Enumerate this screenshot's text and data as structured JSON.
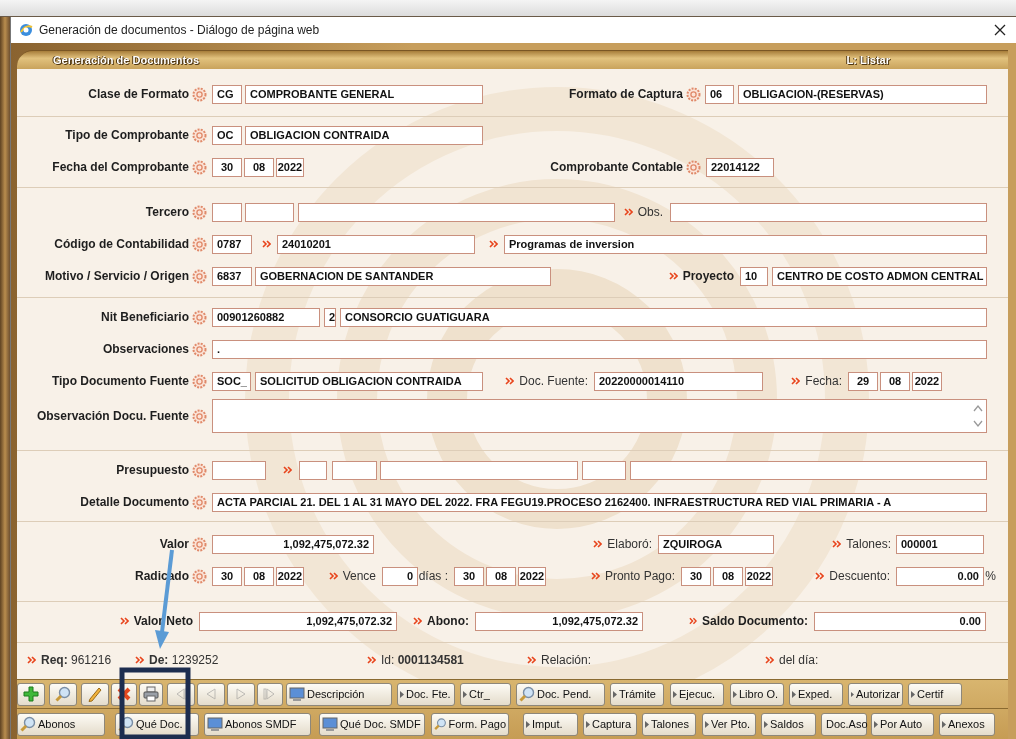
{
  "window": {
    "title": "Generación de documentos - Diálogo de página web"
  },
  "header": {
    "title": "Generación de Documentos",
    "mode": "L: Listar"
  },
  "sections": [
    {
      "rows": [
        {
          "items": [
            {
              "kind": "label",
              "text": "Clase de Formato"
            },
            {
              "kind": "field",
              "value": "CG"
            },
            {
              "kind": "field",
              "value": "COMPROBANTE GENERAL"
            },
            {
              "kind": "label",
              "text": "Formato de Captura"
            },
            {
              "kind": "field",
              "value": "06"
            },
            {
              "kind": "field",
              "value": "OBLIGACION-(RESERVAS)"
            }
          ]
        }
      ]
    },
    {
      "rows": [
        {
          "items": [
            {
              "kind": "label",
              "text": "Tipo de Comprobante"
            },
            {
              "kind": "field",
              "value": "OC"
            },
            {
              "kind": "field",
              "value": "OBLIGACION CONTRAIDA"
            }
          ]
        },
        {
          "items": [
            {
              "kind": "label",
              "text": "Fecha del Comprobante"
            },
            {
              "kind": "date",
              "parts": [
                "30",
                "08",
                "2022"
              ]
            },
            {
              "kind": "label",
              "text": "Comprobante Contable"
            },
            {
              "kind": "field",
              "value": "22014122"
            }
          ]
        }
      ]
    },
    {
      "rows": [
        {
          "items": [
            {
              "kind": "label",
              "text": "Tercero"
            },
            {
              "kind": "field"
            },
            {
              "kind": "field"
            },
            {
              "kind": "field"
            },
            {
              "kind": "caption",
              "chevron": true,
              "text": "Obs."
            },
            {
              "kind": "field"
            }
          ]
        },
        {
          "items": [
            {
              "kind": "label",
              "text": "Código de Contabilidad"
            },
            {
              "kind": "field",
              "value": "0787"
            },
            {
              "kind": "caption",
              "chevron": true
            },
            {
              "kind": "field",
              "value": "24010201"
            },
            {
              "kind": "caption",
              "chevron": true
            },
            {
              "kind": "field",
              "value": "Programas  de inversion"
            }
          ]
        },
        {
          "items": [
            {
              "kind": "label",
              "text": "Motivo / Servicio / Origen"
            },
            {
              "kind": "field",
              "value": "6837"
            },
            {
              "kind": "field",
              "value": "GOBERNACION DE SANTANDER"
            },
            {
              "kind": "bold_caption",
              "chevron": true,
              "text": "Proyecto"
            },
            {
              "kind": "field",
              "value": "10"
            },
            {
              "kind": "field",
              "value": "CENTRO DE COSTO ADMON CENTRAL"
            }
          ]
        }
      ]
    },
    {
      "rows": [
        {
          "items": [
            {
              "kind": "label",
              "text": "Nit Beneficiario"
            },
            {
              "kind": "field",
              "value": "00901260882"
            },
            {
              "kind": "field",
              "value": "2"
            },
            {
              "kind": "field",
              "value": "CONSORCIO GUATIGUARA"
            }
          ]
        },
        {
          "items": [
            {
              "kind": "label",
              "text": "Observaciones"
            },
            {
              "kind": "field",
              "value": "."
            }
          ]
        },
        {
          "items": [
            {
              "kind": "label",
              "text": "Tipo Documento Fuente"
            },
            {
              "kind": "field",
              "value": "SOC_"
            },
            {
              "kind": "field",
              "value": "SOLICITUD OBLIGACION CONTRAIDA"
            },
            {
              "kind": "caption",
              "chevron": true,
              "text": "Doc. Fuente:"
            },
            {
              "kind": "field",
              "value": "20220000014110"
            },
            {
              "kind": "caption",
              "chevron": true,
              "text": "Fecha:"
            },
            {
              "kind": "date",
              "parts": [
                "29",
                "08",
                "2022"
              ]
            }
          ]
        },
        {
          "items": [
            {
              "kind": "label",
              "text": "Observación Docu. Fuente"
            },
            {
              "kind": "textarea"
            }
          ]
        }
      ]
    },
    {
      "rows": [
        {
          "items": [
            {
              "kind": "label",
              "text": "Presupuesto"
            },
            {
              "kind": "field"
            },
            {
              "kind": "caption",
              "chevron": true
            },
            {
              "kind": "field"
            },
            {
              "kind": "field"
            },
            {
              "kind": "field"
            },
            {
              "kind": "field"
            },
            {
              "kind": "field"
            }
          ]
        },
        {
          "items": [
            {
              "kind": "label",
              "text": "Detalle Documento"
            },
            {
              "kind": "field",
              "value": "ACTA PARCIAL 21. DEL 1 AL 31 MAYO DEL 2022. FRA FEGU19.PROCESO 2162400. INFRAESTRUCTURA RED VIAL PRIMARIA - A"
            }
          ]
        }
      ]
    },
    {
      "rows": [
        {
          "items": [
            {
              "kind": "label",
              "text": "Valor"
            },
            {
              "kind": "amount",
              "value": "1,092,475,072.32"
            },
            {
              "kind": "caption",
              "chevron": true,
              "text": "Elaboró:"
            },
            {
              "kind": "field",
              "value": "ZQUIROGA"
            },
            {
              "kind": "caption",
              "chevron": true,
              "text": "Talones:"
            },
            {
              "kind": "field",
              "value": "000001"
            }
          ]
        },
        {
          "items": [
            {
              "kind": "label",
              "text": "Radicado"
            },
            {
              "kind": "date",
              "parts": [
                "30",
                "08",
                "2022"
              ]
            },
            {
              "kind": "caption",
              "chevron": true,
              "text": "Vence"
            },
            {
              "kind": "amount",
              "value": "0"
            },
            {
              "kind": "caption",
              "text": "días :"
            },
            {
              "kind": "date",
              "parts": [
                "30",
                "08",
                "2022"
              ]
            },
            {
              "kind": "caption",
              "chevron": true,
              "text": "Pronto Pago:"
            },
            {
              "kind": "date",
              "parts": [
                "30",
                "08",
                "2022"
              ]
            },
            {
              "kind": "caption",
              "chevron": true,
              "text": "Descuento:"
            },
            {
              "kind": "amount",
              "value": "0.00"
            },
            {
              "kind": "caption",
              "text": "%"
            }
          ]
        }
      ]
    },
    {
      "rows": [
        {
          "items": [
            {
              "kind": "bold_caption",
              "chevron": true,
              "text": "Valor Neto"
            },
            {
              "kind": "amount",
              "value": "1,092,475,072.32"
            },
            {
              "kind": "bold_caption",
              "chevron": true,
              "text": "Abono:"
            },
            {
              "kind": "amount",
              "value": "1,092,475,072.32"
            },
            {
              "kind": "bold_caption",
              "chevron": true,
              "text": "Saldo Documento:"
            },
            {
              "kind": "amount",
              "value": "0.00"
            }
          ]
        }
      ]
    },
    {
      "rows": [
        {
          "items": [
            {
              "kind": "caption",
              "chevron": true,
              "text": "**Req:** 961216"
            },
            {
              "kind": "caption",
              "chevron": true,
              "text": "**De:** 1239252"
            },
            {
              "kind": "caption",
              "chevron": true,
              "text": "Id: **0001134581**"
            },
            {
              "kind": "caption",
              "chevron": true,
              "text": "Relación:"
            },
            {
              "kind": "caption",
              "chevron": true,
              "text": "del día:"
            }
          ]
        }
      ]
    }
  ],
  "toolbars": [
    {
      "buttons": [
        {
          "kind": "add",
          "disabled": false
        },
        {
          "kind": "find",
          "disabled": false
        },
        {
          "kind": "edit",
          "disabled": false
        },
        {
          "kind": "delete",
          "disabled": false
        },
        {
          "kind": "print",
          "disabled": false
        },
        {
          "kind": "first",
          "disabled": true
        },
        {
          "kind": "prev",
          "disabled": true
        },
        {
          "kind": "next",
          "disabled": true
        },
        {
          "kind": "last",
          "disabled": true
        },
        {
          "kind": "monitor",
          "label": "Descripción",
          "disabled": false
        },
        {
          "kind": "arrow",
          "label": "Doc. Fte.",
          "disabled": false
        },
        {
          "kind": "arrow",
          "label": "Ctr_",
          "disabled": false
        },
        {
          "kind": "search",
          "label": "Doc. Pend.",
          "disabled": false
        },
        {
          "kind": "arrow",
          "label": "Trámite",
          "disabled": false
        },
        {
          "kind": "arrow",
          "label": "Ejecuc.",
          "disabled": false
        },
        {
          "kind": "arrow",
          "label": "Libro O.",
          "disabled": false
        },
        {
          "kind": "arrow",
          "label": "Exped.",
          "disabled": false
        },
        {
          "kind": "arrow",
          "label": "Autorizar",
          "disabled": false
        },
        {
          "kind": "arrow",
          "label": "Certif",
          "disabled": false
        }
      ]
    },
    {
      "buttons": [
        {
          "kind": "search",
          "label": "Abonos",
          "disabled": false
        },
        {
          "kind": "search",
          "label": "Qué Doc.",
          "disabled": false
        },
        {
          "kind": "monitor",
          "label": "Abonos SMDF",
          "disabled": false
        },
        {
          "kind": "monitor",
          "label": "Qué Doc. SMDF",
          "disabled": false
        },
        {
          "kind": "search",
          "label": "Form. Pago",
          "disabled": false
        },
        {
          "kind": "arrow",
          "label": "Imput.",
          "disabled": false
        },
        {
          "kind": "arrow",
          "label": "Captura",
          "disabled": false
        },
        {
          "kind": "arrow",
          "label": "Talones",
          "disabled": false
        },
        {
          "kind": "arrow",
          "label": "Ver Pto.",
          "disabled": false
        },
        {
          "kind": "arrow",
          "label": "Saldos",
          "disabled": false
        },
        {
          "kind": "arrow",
          "label": "Doc.Aso",
          "disabled": false
        },
        {
          "kind": "arrow",
          "label": "Por Auto",
          "disabled": false
        },
        {
          "kind": "arrow",
          "label": "Anexos",
          "disabled": false
        }
      ]
    }
  ]
}
